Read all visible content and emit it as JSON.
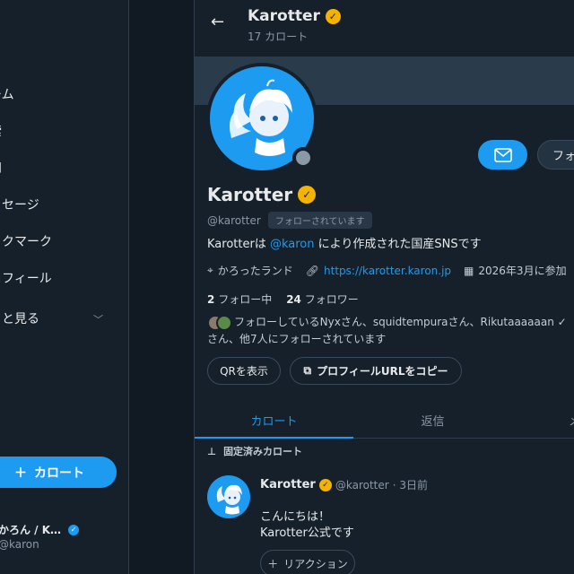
{
  "sidebar": {
    "items": [
      {
        "label": "ーム"
      },
      {
        "label": "索"
      },
      {
        "label": "知"
      },
      {
        "label": "ッセージ"
      },
      {
        "label": "ックマーク"
      },
      {
        "label": "ロフィール"
      },
      {
        "label": "っと見る"
      }
    ],
    "post_button": "カロート",
    "account": {
      "name": "かろん / K…",
      "handle": "@karon"
    }
  },
  "header": {
    "title": "Karotter",
    "subtitle": "17 カロート"
  },
  "profile": {
    "name": "Karotter",
    "handle": "@karotter",
    "follows_you": "フォローされています",
    "bio_prefix": "Karotterは ",
    "bio_mention": "@karon",
    "bio_suffix": " により作成された国産SNSです",
    "location": "かろったランド",
    "url": "https://karotter.karon.jp",
    "joined": "2026年3月に参加",
    "following_count": "2",
    "following_label": "フォロー中",
    "followers_count": "24",
    "followers_label": "フォロワー",
    "known_followers": "フォローしているNyxさん、squidtempuraさん、Rikutaaaaaan ✓さん、他7人にフォローされています",
    "follow_button": "フォロー",
    "qr_button": "QRを表示",
    "copy_button": "プロフィールURLをコピー"
  },
  "tabs": [
    {
      "label": "カロート",
      "active": true
    },
    {
      "label": "返信",
      "active": false
    },
    {
      "label": "メディア",
      "active": false
    }
  ],
  "pinned": {
    "label": "固定済みカロート",
    "author": "Karotter",
    "handle": "@karotter",
    "time": "· 3日前",
    "body_line1": "こんにちは！",
    "body_line2": "Karotter公式です",
    "reaction_button": "リアクション"
  },
  "colors": {
    "accent": "#1d9bf0",
    "verified_gold": "#f5b301",
    "background": "#15202b"
  }
}
